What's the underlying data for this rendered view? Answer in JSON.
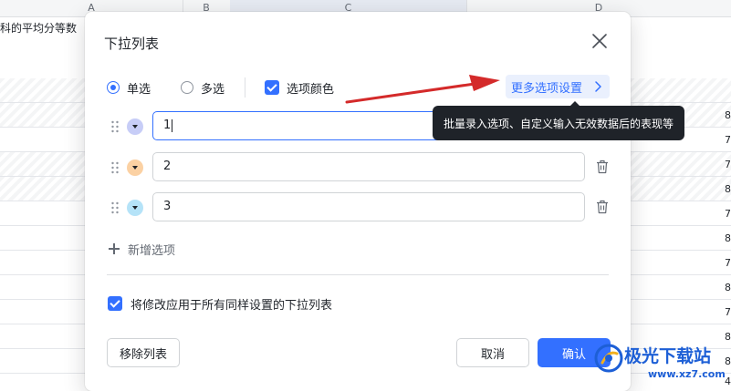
{
  "spreadsheet": {
    "columns": [
      "A",
      "B",
      "C",
      "D"
    ],
    "cell_a1_text": "科的平均分等数",
    "right_edge_values": [
      "8",
      "7",
      "7",
      "8",
      "7",
      "8",
      "7",
      "8",
      "7",
      "8",
      "8",
      "4"
    ]
  },
  "dialog": {
    "title": "下拉列表",
    "mode_single_label": "单选",
    "mode_multi_label": "多选",
    "option_color_label": "选项颜色",
    "more_settings_label": "更多选项设置",
    "items": [
      {
        "value": "1",
        "color": "#c7cdf7"
      },
      {
        "value": "2",
        "color": "#fbd1a3"
      },
      {
        "value": "3",
        "color": "#b5e3f8"
      }
    ],
    "add_option_label": "新增选项",
    "apply_all_label": "将修改应用于所有同样设置的下拉列表",
    "remove_list_label": "移除列表",
    "cancel_label": "取消",
    "confirm_label": "确认"
  },
  "tooltip": {
    "text": "批量录入选项、自定义输入无效数据后的表现等"
  },
  "watermark": {
    "brand": "极光下载站",
    "url": "www.xz7.com"
  },
  "colors": {
    "accent": "#3370ff",
    "arrow": "#d42a2a",
    "tooltip_bg": "#1f2329"
  }
}
